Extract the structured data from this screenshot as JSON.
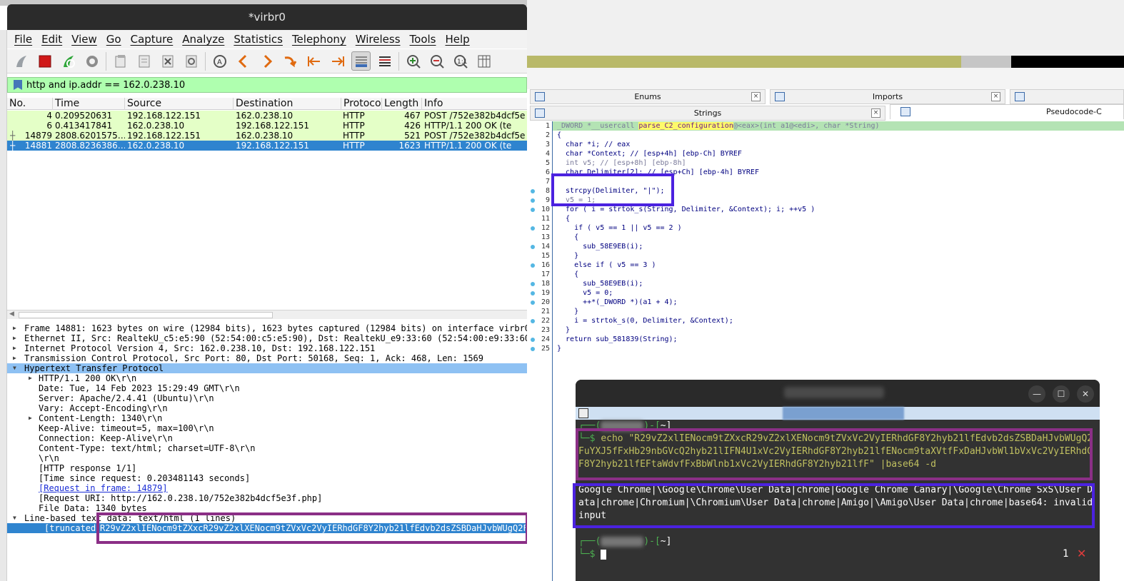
{
  "wireshark": {
    "title": "*virbr0",
    "menu": [
      "File",
      "Edit",
      "View",
      "Go",
      "Capture",
      "Analyze",
      "Statistics",
      "Telephony",
      "Wireless",
      "Tools",
      "Help"
    ],
    "filter": "http and ip.addr == 162.0.238.10",
    "columns": [
      "No.",
      "Time",
      "Source",
      "Destination",
      "Protoco",
      "Length",
      "Info"
    ],
    "packets": [
      {
        "no": "4",
        "time": "0.209520631",
        "src": "192.168.122.151",
        "dst": "162.0.238.10",
        "proto": "HTTP",
        "len": "467",
        "info": "POST /752e382b4dcf5e"
      },
      {
        "no": "6",
        "time": "0.413417841",
        "src": "162.0.238.10",
        "dst": "192.168.122.151",
        "proto": "HTTP",
        "len": "426",
        "info": "HTTP/1.1 200 OK  (te"
      },
      {
        "no": "14879",
        "time": "2808.6201575…",
        "src": "192.168.122.151",
        "dst": "162.0.238.10",
        "proto": "HTTP",
        "len": "521",
        "info": "POST /752e382b4dcf5e"
      },
      {
        "no": "14881",
        "time": "2808.8236386…",
        "src": "162.0.238.10",
        "dst": "192.168.122.151",
        "proto": "HTTP",
        "len": "1623",
        "info": "HTTP/1.1 200 OK  (te"
      }
    ],
    "details": [
      "Frame 14881: 1623 bytes on wire (12984 bits), 1623 bytes captured (12984 bits) on interface virbr0",
      "Ethernet II, Src: RealtekU_c5:e5:90 (52:54:00:c5:e5:90), Dst: RealtekU_e9:33:60 (52:54:00:e9:33:60",
      "Internet Protocol Version 4, Src: 162.0.238.10, Dst: 192.168.122.151",
      "Transmission Control Protocol, Src Port: 80, Dst Port: 50168, Seq: 1, Ack: 468, Len: 1569",
      "Hypertext Transfer Protocol",
      "HTTP/1.1 200 OK\\r\\n",
      "Date: Tue, 14 Feb 2023 15:29:49 GMT\\r\\n",
      "Server: Apache/2.4.41 (Ubuntu)\\r\\n",
      "Vary: Accept-Encoding\\r\\n",
      "Content-Length: 1340\\r\\n",
      "Keep-Alive: timeout=5, max=100\\r\\n",
      "Connection: Keep-Alive\\r\\n",
      "Content-Type: text/html; charset=UTF-8\\r\\n",
      "\\r\\n",
      "[HTTP response 1/1]",
      "[Time since request: 0.203481143 seconds]",
      "[Request in frame: 14879]",
      "[Request URI: http://162.0.238.10/752e382b4dcf5e3f.php]",
      "File Data: 1340 bytes",
      "Line-based text data: text/html (1 lines)",
      "[truncated]",
      "R29vZ2xlIENocm9tZXxcR29vZ2xlXENocm9tZVxVc2VyIERhdGF8Y2hyb21lfEdvb2dsZSBDaHJvbWUgQ2Fu"
    ]
  },
  "ida": {
    "tabs": {
      "enums": "Enums",
      "imports": "Imports",
      "strings": "Strings",
      "pseudocode": "Pseudocode-C"
    },
    "code": [
      {
        "n": "1",
        "t": "_DWORD *__usercall parse_C2_configuration@<eax>(int a1@<edi>, char *String)"
      },
      {
        "n": "2",
        "t": "{"
      },
      {
        "n": "3",
        "t": "  char *i; // eax"
      },
      {
        "n": "4",
        "t": "  char *Context; // [esp+4h] [ebp-Ch] BYREF"
      },
      {
        "n": "5",
        "t": "  int v5; // [esp+8h] [ebp-8h]"
      },
      {
        "n": "6",
        "t": "  char Delimiter[2]; // [esp+Ch] [ebp-4h] BYREF"
      },
      {
        "n": "7",
        "t": ""
      },
      {
        "n": "8",
        "t": "  strcpy(Delimiter, \"|\");"
      },
      {
        "n": "9",
        "t": "  v5 = 1;"
      },
      {
        "n": "10",
        "t": "  for ( i = strtok_s(String, Delimiter, &Context); i; ++v5 )"
      },
      {
        "n": "11",
        "t": "  {"
      },
      {
        "n": "12",
        "t": "    if ( v5 == 1 || v5 == 2 )"
      },
      {
        "n": "13",
        "t": "    {"
      },
      {
        "n": "14",
        "t": "      sub_58E9EB(i);"
      },
      {
        "n": "15",
        "t": "    }"
      },
      {
        "n": "16",
        "t": "    else if ( v5 == 3 )"
      },
      {
        "n": "17",
        "t": "    {"
      },
      {
        "n": "18",
        "t": "      sub_58E9EB(i);"
      },
      {
        "n": "19",
        "t": "      v5 = 0;"
      },
      {
        "n": "20",
        "t": "      ++*(_DWORD *)(a1 + 4);"
      },
      {
        "n": "21",
        "t": "    }"
      },
      {
        "n": "22",
        "t": "    i = strtok_s(0, Delimiter, &Context);"
      },
      {
        "n": "23",
        "t": "  }"
      },
      {
        "n": "24",
        "t": "  return sub_581839(String);"
      },
      {
        "n": "25",
        "t": "}"
      }
    ]
  },
  "terminal": {
    "prompt_tilde": "~]",
    "echo_cmd": "echo \"R29vZ2xlIENocm9tZXxcR29vZ2xlXENocm9tZVxVc2VyIERhdGF8Y2hyb21lfEdvb2dsZSBDaHJvbWUgQ2FuYXJ5fFxHb29nbGVcQ2hyb21lIFN4U1xVc2VyIERhdGF8Y2hyb21lfENocm9taXVtfFxDaHJvbWl1bVxVc2VyIERhdGF8Y2hyb21lfEFtaWdvfFxBbWlnb1xVc2VyIERhdGF8Y2hyb21lfF\" |base64 -d",
    "output": "Google Chrome|\\Google\\Chrome\\User Data|chrome|Google Chrome Canary|\\Google\\Chrome SxS\\User Data|chrome|Chromium|\\Chromium\\User Data|chrome|Amigo|\\Amigo\\User Data|chrome|base64: invalid input",
    "job_count": "1"
  }
}
